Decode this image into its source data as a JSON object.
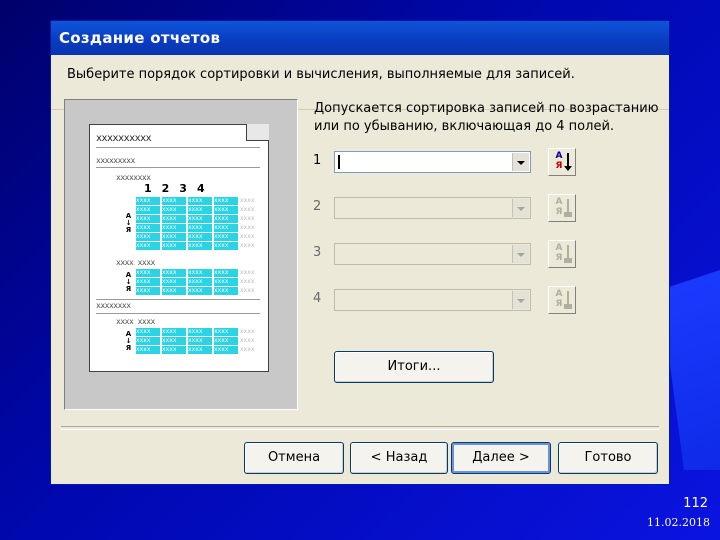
{
  "dialog": {
    "title": "Создание отчетов",
    "instruction": "Выберите порядок сортировки и вычисления, выполняемые для записей.",
    "description_line1": "Допускается сортировка записей по возрастанию",
    "description_line2": "или по убыванию, включающая до 4 полей."
  },
  "preview": {
    "header_x": "xxxxxxxxxx",
    "group1_x": "xxxxxxxxx",
    "sub1_x": "xxxxxxxx",
    "col_numbers": "1234",
    "sub2_x": "xxxx xxxx",
    "group2_x": "xxxxxxxx",
    "sub3_x": "xxxx xxxx",
    "sort_icon_top": "А",
    "sort_icon_bottom": "Я",
    "cell_text": "xxxx"
  },
  "sort_fields": [
    {
      "number": "1",
      "value": "",
      "enabled": true
    },
    {
      "number": "2",
      "value": "",
      "enabled": false
    },
    {
      "number": "3",
      "value": "",
      "enabled": false
    },
    {
      "number": "4",
      "value": "",
      "enabled": false
    }
  ],
  "sort_button": {
    "top": "А",
    "bottom": "Я"
  },
  "buttons": {
    "summary": "Итоги...",
    "cancel": "Отмена",
    "back": "< Назад",
    "next": "Далее >",
    "finish": "Готово"
  },
  "slide": {
    "number": "112",
    "date": "11.02.2018"
  },
  "colors": {
    "title_bar": "#0a3cc0",
    "dialog_bg": "#ece9d8",
    "preview_cell": "#2ad4e4",
    "slide_bg": "#0a10c8"
  }
}
